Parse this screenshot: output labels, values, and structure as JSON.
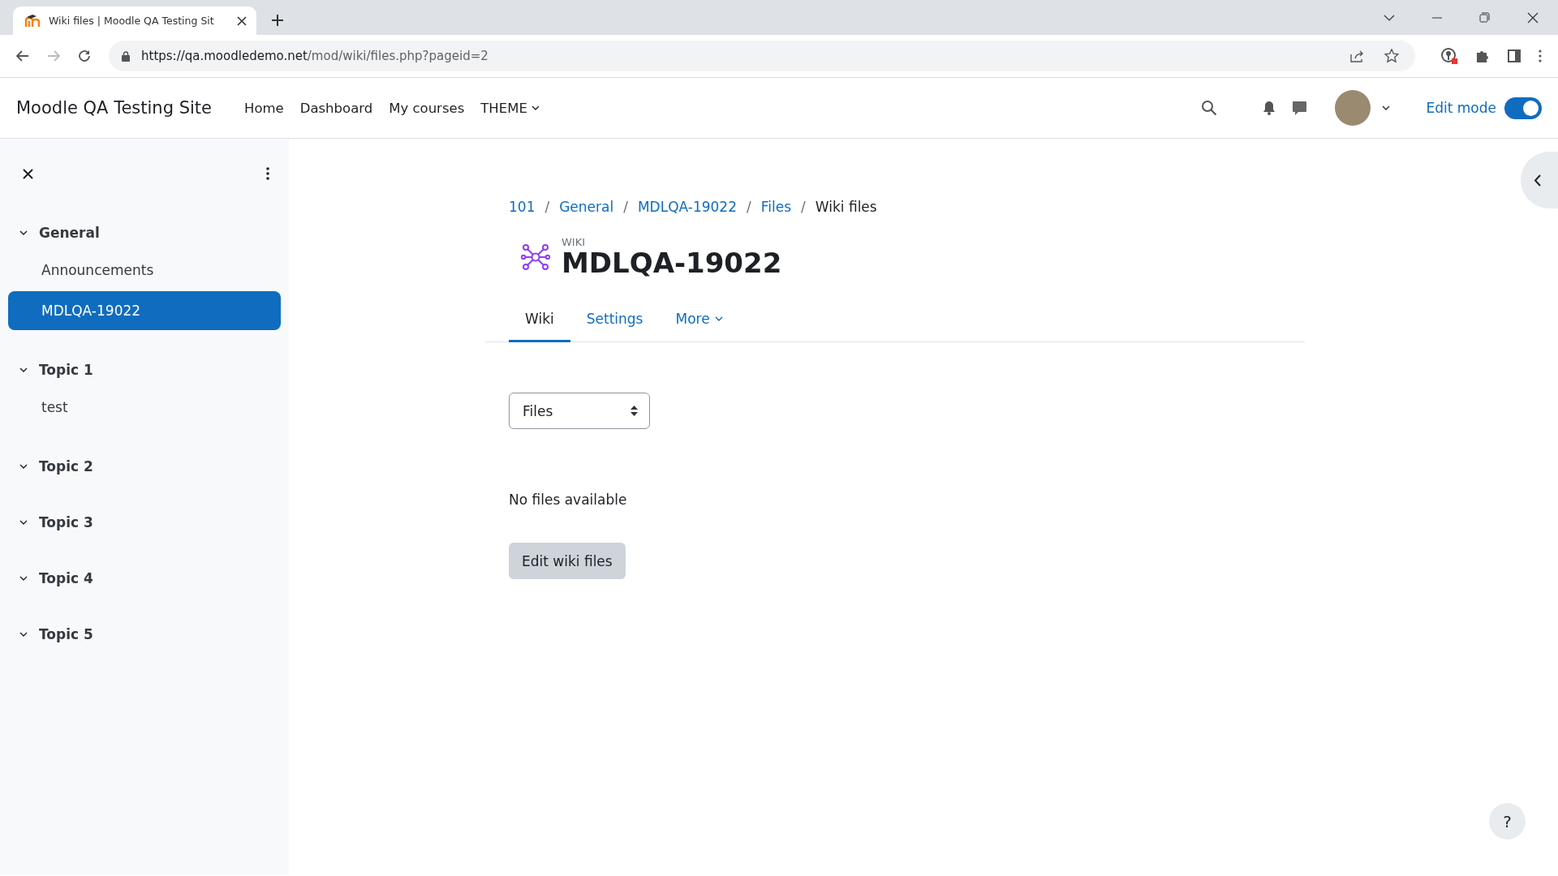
{
  "browser": {
    "tab_title": "Wiki files | Moodle QA Testing Sit",
    "url_host": "https://qa.moodledemo.net",
    "url_path": "/mod/wiki/files.php?pageid=2"
  },
  "navbar": {
    "site_name": "Moodle QA Testing Site",
    "links": [
      {
        "label": "Home",
        "dropdown": false
      },
      {
        "label": "Dashboard",
        "dropdown": false
      },
      {
        "label": "My courses",
        "dropdown": false
      },
      {
        "label": "THEME",
        "dropdown": true
      }
    ],
    "edit_mode": {
      "label": "Edit mode",
      "on": true
    }
  },
  "sidebar": {
    "sections": [
      {
        "title": "General",
        "expanded": true,
        "children": [
          {
            "label": "Announcements",
            "selected": false
          },
          {
            "label": "MDLQA-19022",
            "selected": true
          }
        ]
      },
      {
        "title": "Topic 1",
        "expanded": true,
        "children": [
          {
            "label": "test",
            "selected": false
          }
        ]
      },
      {
        "title": "Topic 2",
        "expanded": true
      },
      {
        "title": "Topic 3",
        "expanded": true
      },
      {
        "title": "Topic 4",
        "expanded": true
      },
      {
        "title": "Topic 5",
        "expanded": true
      }
    ]
  },
  "breadcrumb_separator": "/",
  "breadcrumb": [
    {
      "label": "101",
      "link": true
    },
    {
      "label": "General",
      "link": true
    },
    {
      "label": "MDLQA-19022",
      "link": true
    },
    {
      "label": "Files",
      "link": true
    },
    {
      "label": "Wiki files",
      "link": false
    }
  ],
  "header": {
    "type_label": "WIKI",
    "title": "MDLQA-19022"
  },
  "tabs": [
    {
      "label": "Wiki",
      "selected": true,
      "dropdown": false
    },
    {
      "label": "Settings",
      "selected": false,
      "dropdown": false
    },
    {
      "label": "More",
      "selected": false,
      "dropdown": true
    }
  ],
  "select": {
    "value": "Files"
  },
  "message": "No files available",
  "button": "Edit wiki files",
  "help": "?"
}
